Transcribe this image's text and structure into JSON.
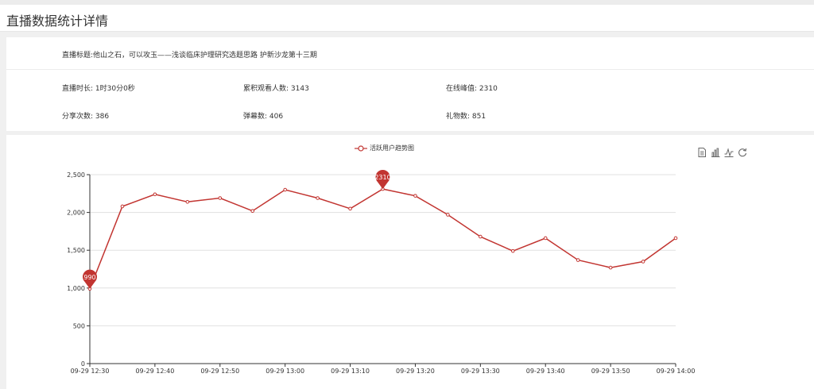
{
  "page": {
    "title": "直播数据统计详情"
  },
  "info": {
    "stream_title": "直播标题:他山之石，可以攻玉——浅谈临床护理研究选题思路 护新沙龙第十三期",
    "duration": "直播时长: 1时30分0秒",
    "total_viewers": "累积观看人数: 3143",
    "peak_online": "在线峰值: 2310",
    "shares": "分享次数: 386",
    "danmaku": "弹幕数: 406",
    "gifts": "礼物数: 851"
  },
  "toolbox": [
    {
      "name": "data-view-icon"
    },
    {
      "name": "bar-chart-icon"
    },
    {
      "name": "line-chart-icon"
    },
    {
      "name": "restore-icon"
    }
  ],
  "colors": {
    "series": "#c23531",
    "grid": "#e0e0e0",
    "axis": "#333333"
  },
  "chart_data": {
    "type": "line",
    "legend": "活跃用户趋势图",
    "legend_position": "top-center",
    "grid": true,
    "ylim": [
      0,
      2500
    ],
    "yticks": [
      0,
      500,
      1000,
      1500,
      2000,
      2500
    ],
    "ytick_labels": [
      "0",
      "500",
      "1,000",
      "1,500",
      "2,000",
      "2,500"
    ],
    "xlim": [
      "09-29 12:30",
      "09-29 14:00"
    ],
    "xticks": [
      "09-29 12:30",
      "09-29 12:40",
      "09-29 12:50",
      "09-29 13:00",
      "09-29 13:10",
      "09-29 13:20",
      "09-29 13:30",
      "09-29 13:40",
      "09-29 13:50",
      "09-29 14:00"
    ],
    "series": [
      {
        "name": "活跃用户趋势图",
        "x": [
          "09-29 12:30",
          "09-29 12:35",
          "09-29 12:40",
          "09-29 12:45",
          "09-29 12:50",
          "09-29 12:55",
          "09-29 13:00",
          "09-29 13:05",
          "09-29 13:10",
          "09-29 13:15",
          "09-29 13:20",
          "09-29 13:25",
          "09-29 13:30",
          "09-29 13:35",
          "09-29 13:40",
          "09-29 13:45",
          "09-29 13:50",
          "09-29 13:55",
          "09-29 14:00"
        ],
        "values": [
          990,
          2080,
          2240,
          2140,
          2190,
          2020,
          2300,
          2190,
          2050,
          2310,
          2220,
          1970,
          1680,
          1490,
          1660,
          1370,
          1270,
          1350,
          1660
        ]
      }
    ],
    "markers": [
      {
        "label": "990",
        "x": "09-29 12:30",
        "value": 990
      },
      {
        "label": "2310",
        "x": "09-29 13:15",
        "value": 2310
      }
    ]
  }
}
